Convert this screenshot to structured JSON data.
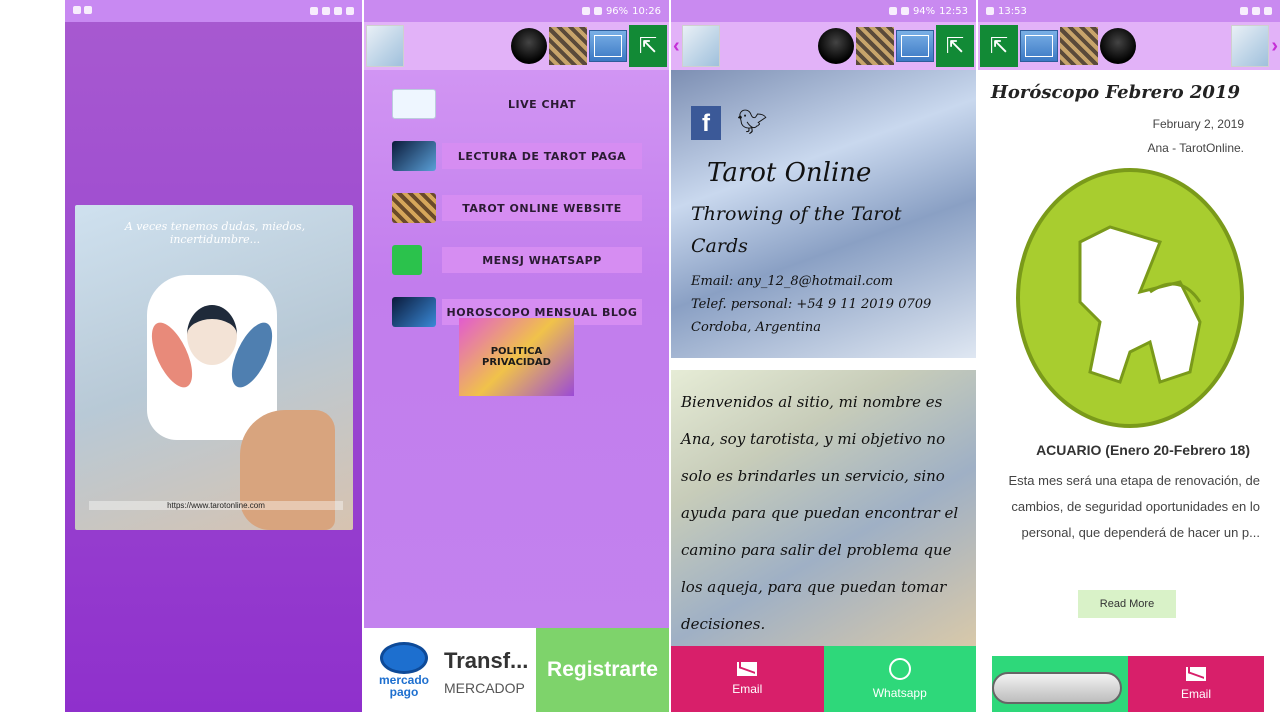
{
  "panel1": {
    "status_time": "",
    "splash_caption": "A veces tenemos dudas, miedos, incertidumbre...",
    "splash_url": "https://www.tarotonline.com"
  },
  "panel2": {
    "status_time": "10:26",
    "status_battery": "96%",
    "menu": [
      {
        "label": "LIVE CHAT",
        "icon": "chat-icon"
      },
      {
        "label": "LECTURA DE TAROT PAGA",
        "icon": "tarot-paid-icon"
      },
      {
        "label": "TAROT ONLINE WEBSITE",
        "icon": "website-icon"
      },
      {
        "label": "MENSJ WHATSAPP",
        "icon": "whatsapp-icon"
      },
      {
        "label": "HOROSCOPO MENSUAL  BLOG",
        "icon": "horoscope-icon"
      }
    ],
    "policy_label": "POLITICA PRIVACIDAD",
    "ad": {
      "brand_line1": "mercado",
      "brand_line2": "pago",
      "title": "Transf...",
      "subtitle": "MERCADOP",
      "cta": "Registrarte"
    }
  },
  "panel3": {
    "status_time": "12:53",
    "status_battery": "94%",
    "hero_title": "Tarot Online",
    "hero_subtitle": "Throwing of the Tarot Cards",
    "hero_email": "Email: any_12_8@hotmail.com",
    "hero_phone": "Telef. personal: +54 9 11 2019 0709",
    "hero_location": "Cordoba, Argentina",
    "intro_text": "Bienvenidos al sitio, mi nombre es Ana, soy tarotista, y mi objetivo no solo es brindarles un servicio, sino ayuda para que puedan encontrar el camino para salir del problema que los aqueja, para que puedan tomar decisiones.",
    "email_label": "Email",
    "whatsapp_label": "Whatsapp"
  },
  "panel4": {
    "status_time": "13:53",
    "post_title": "Horóscopo Febrero 2019",
    "post_date": "February 2, 2019",
    "post_author": "Ana - TarotOnline.",
    "sign_name": "ACUARIO (Enero 20-Febrero 18)",
    "sign_text": "Esta mes será una etapa de renovación, de cambios, de seguridad oportunidades en lo personal, que dependerá de hacer un p...",
    "read_more": "Read More",
    "email_label": "Email"
  },
  "colors": {
    "purple_bg": "#a85ad0",
    "accent_green": "#2ed87a",
    "accent_pink": "#d81f6a",
    "zodiac_green": "#a8cd2f"
  }
}
